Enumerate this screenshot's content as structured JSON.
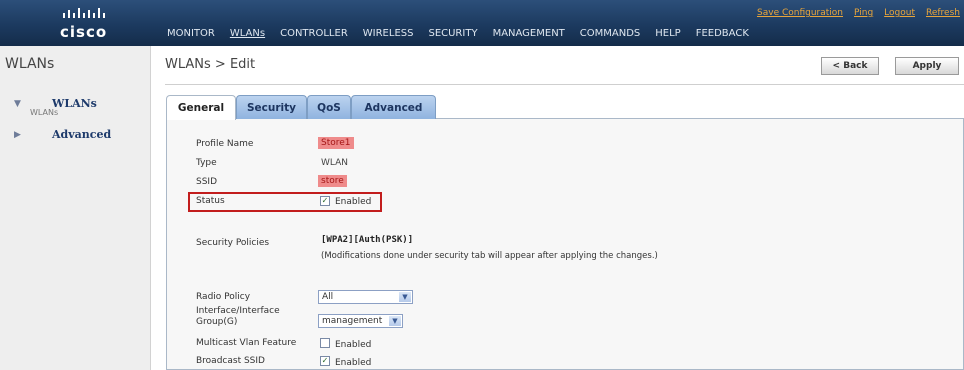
{
  "header": {
    "logo_text": "cisco",
    "utility_links": [
      "Save Configuration",
      "Ping",
      "Logout",
      "Refresh"
    ],
    "nav_items": [
      "MONITOR",
      "WLANs",
      "CONTROLLER",
      "WIRELESS",
      "SECURITY",
      "MANAGEMENT",
      "COMMANDS",
      "HELP",
      "FEEDBACK"
    ],
    "active_nav": "WLANs",
    "colors": {
      "header_bg": "#1c3a5f",
      "utility_link": "#e8a53c"
    }
  },
  "sidebar": {
    "heading": "WLANs",
    "items": [
      {
        "label": "WLANs",
        "sub": "WLANs",
        "expanded": true
      },
      {
        "label": "Advanced",
        "expanded": false
      }
    ]
  },
  "main": {
    "breadcrumb": "WLANs > Edit",
    "back_button": "< Back",
    "apply_button": "Apply",
    "tabs": [
      "General",
      "Security",
      "QoS",
      "Advanced"
    ],
    "active_tab": "General"
  },
  "general": {
    "profile_name": {
      "label": "Profile Name",
      "value": "Store1"
    },
    "type": {
      "label": "Type",
      "value": "WLAN"
    },
    "ssid": {
      "label": "SSID",
      "value": "store"
    },
    "status": {
      "label": "Status",
      "checkbox_label": "Enabled",
      "checked": true
    },
    "security_policies": {
      "label": "Security Policies",
      "value": "[WPA2][Auth(PSK)]",
      "note": "(Modifications done under security tab will appear after applying the changes.)"
    },
    "radio_policy": {
      "label": "Radio Policy",
      "selected": "All"
    },
    "interface_group": {
      "label": "Interface/Interface Group(G)",
      "selected": "management"
    },
    "multicast_vlan": {
      "label": "Multicast Vlan Feature",
      "checkbox_label": "Enabled",
      "checked": false
    },
    "broadcast_ssid": {
      "label": "Broadcast SSID",
      "checkbox_label": "Enabled",
      "checked": true
    }
  }
}
